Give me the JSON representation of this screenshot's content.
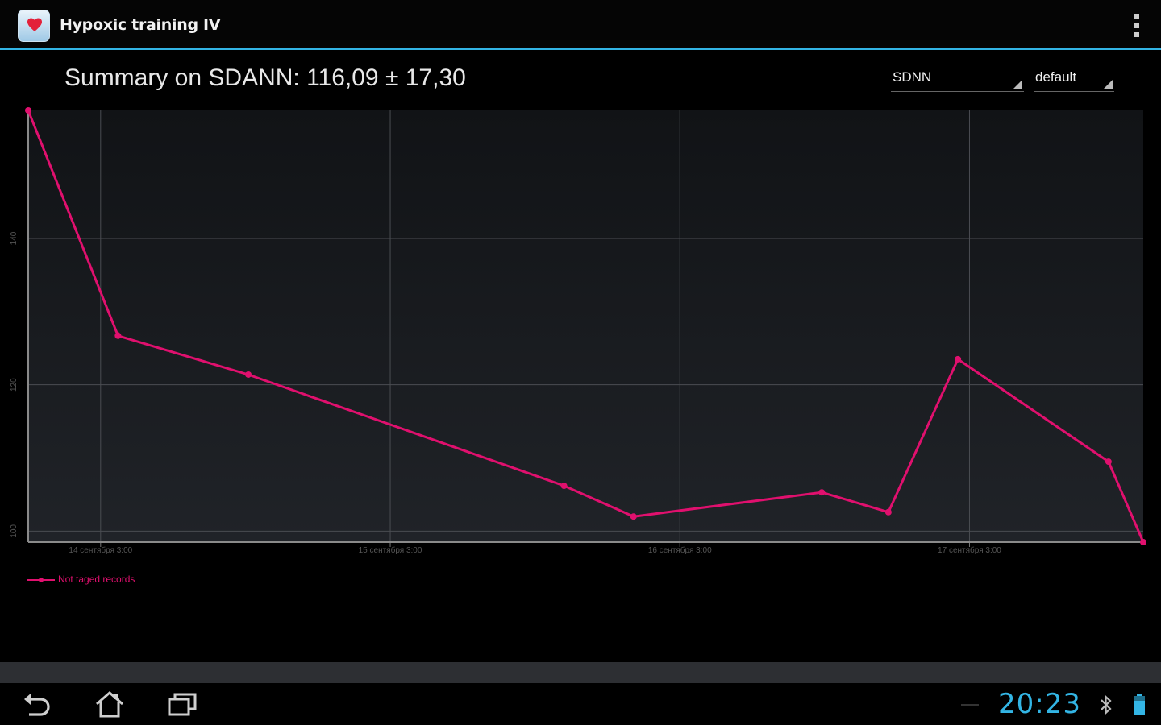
{
  "app": {
    "title": "Hypoxic training IV",
    "icon": "heart-app-icon",
    "menu_icon": "overflow-menu-icon"
  },
  "summary": {
    "title": "Summary on SDANN: 116,09 ± 17,30"
  },
  "spinners": {
    "metric": "SDNN",
    "profile": "default"
  },
  "colors": {
    "accent": "#33b5e5",
    "series": "#e0106e",
    "background": "#000000"
  },
  "chart_data": {
    "type": "line",
    "x_unit": "days",
    "x_ticks": [
      {
        "value": 14,
        "label": "14 сентября 3:00"
      },
      {
        "value": 15,
        "label": "15 сентября 3:00"
      },
      {
        "value": 16,
        "label": "16 сентября 3:00"
      },
      {
        "value": 17,
        "label": "17 сентября 3:00"
      }
    ],
    "y_ticks": [
      100,
      120,
      140
    ],
    "xlim": [
      13.75,
      17.6
    ],
    "ylim": [
      98.5,
      157.5
    ],
    "grid": true,
    "legend": "bottom-left",
    "series": [
      {
        "name": "Not taged records",
        "points": [
          {
            "x": 13.75,
            "y": 157.5
          },
          {
            "x": 14.06,
            "y": 126.7
          },
          {
            "x": 14.51,
            "y": 121.4
          },
          {
            "x": 15.6,
            "y": 106.2
          },
          {
            "x": 15.84,
            "y": 102.0
          },
          {
            "x": 16.49,
            "y": 105.3
          },
          {
            "x": 16.72,
            "y": 102.6
          },
          {
            "x": 16.96,
            "y": 123.5
          },
          {
            "x": 17.48,
            "y": 109.5
          },
          {
            "x": 17.6,
            "y": 98.5
          }
        ]
      }
    ]
  },
  "status_bar": {
    "time": "20:23",
    "nav_buttons": [
      "back-icon",
      "home-icon",
      "recent-apps-icon"
    ],
    "indicators": [
      "bluetooth-icon",
      "battery-icon"
    ]
  }
}
